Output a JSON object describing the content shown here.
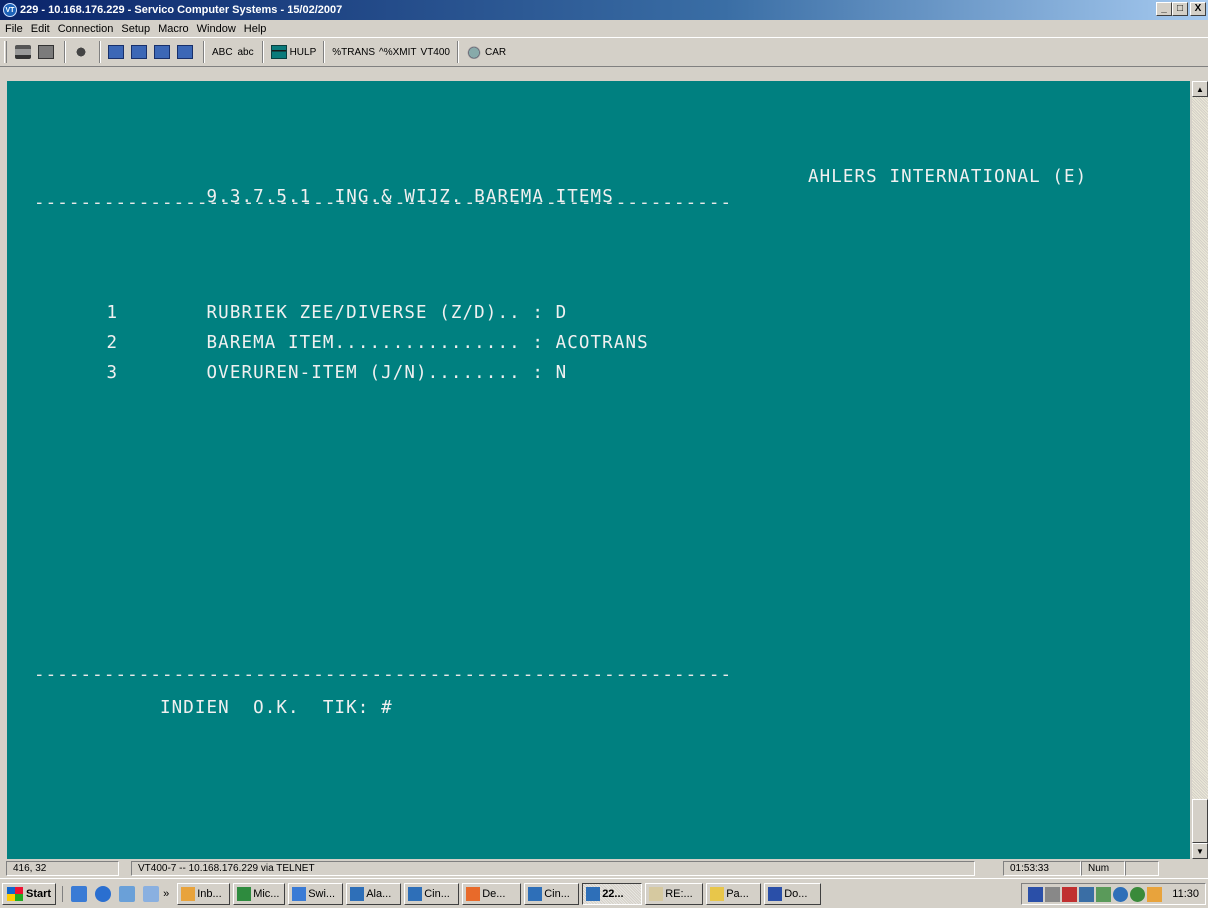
{
  "window": {
    "title": "229 - 10.168.176.229 - Servico Computer Systems - 15/02/2007",
    "icon_text": "VT",
    "minimize": "_",
    "maximize": "□",
    "close": "X"
  },
  "menu": [
    "File",
    "Edit",
    "Connection",
    "Setup",
    "Macro",
    "Window",
    "Help"
  ],
  "toolbar": {
    "abc_upper": "ABC",
    "abc_lower": "abc",
    "hulp": "HULP",
    "trans": "%TRANS",
    "xmit": "^%XMIT",
    "vt400": "VT400",
    "car": "CAR"
  },
  "screen": {
    "header_code": "9.3.7.5.1",
    "header_title": "ING.& WIJZ. BAREMA ITEMS",
    "company": "AHLERS INTERNATIONAL (E)",
    "separator": "------------------------------------------------------------",
    "fields": [
      {
        "num": "1",
        "label": "RUBRIEK ZEE/DIVERSE (Z/D)..",
        "sep": ":",
        "value": "D"
      },
      {
        "num": "2",
        "label": "BAREMA ITEM................",
        "sep": ":",
        "value": "ACOTRANS"
      },
      {
        "num": "3",
        "label": "OVERUREN-ITEM (J/N)........",
        "sep": ":",
        "value": "N"
      }
    ],
    "prompt": "INDIEN  O.K.  TIK: #"
  },
  "statusbar": {
    "cursor": "416, 32",
    "connection": "VT400-7 -- 10.168.176.229 via TELNET",
    "time": "01:53:33",
    "numlock": "Num"
  },
  "taskbar": {
    "start": "Start",
    "more": "»",
    "tasks": [
      {
        "label": "Inb...",
        "color": "#e8a33c"
      },
      {
        "label": "Mic...",
        "color": "#2e8b3e"
      },
      {
        "label": "Swi...",
        "color": "#3a7bd5"
      },
      {
        "label": "Ala...",
        "color": "#2e6fb8"
      },
      {
        "label": "Cin...",
        "color": "#2e6fb8"
      },
      {
        "label": "De...",
        "color": "#e86a2a"
      },
      {
        "label": "Cin...",
        "color": "#2e6fb8"
      },
      {
        "label": "22...",
        "color": "#2e6fb8",
        "active": true
      },
      {
        "label": "RE:...",
        "color": "#d6c9a0"
      },
      {
        "label": "Pa...",
        "color": "#e8c64a"
      },
      {
        "label": "Do...",
        "color": "#2a4fa8"
      }
    ],
    "clock": "11:30"
  }
}
